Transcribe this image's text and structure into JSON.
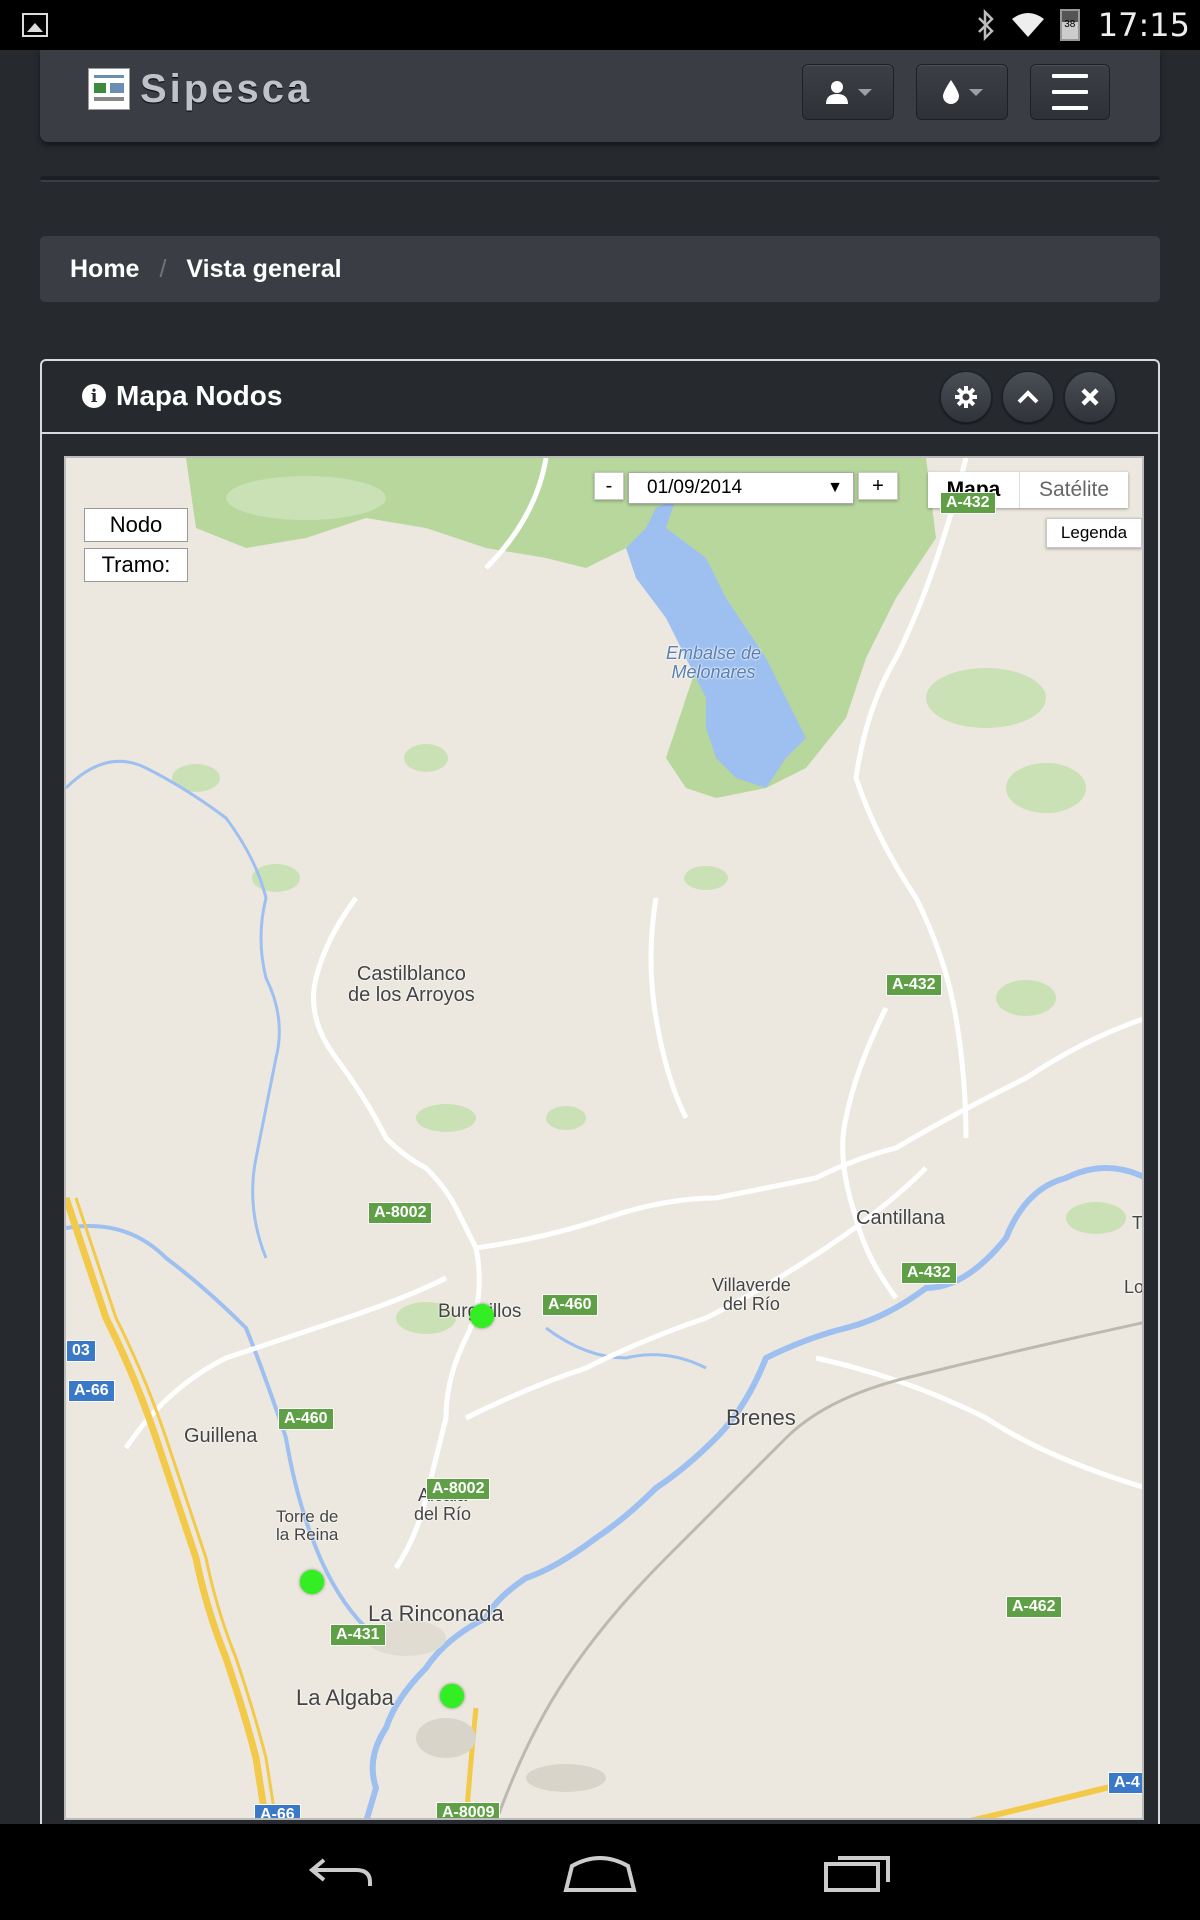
{
  "status_bar": {
    "time": "17:15",
    "battery_level": "38",
    "icons": [
      "gallery-icon",
      "bluetooth-icon",
      "wifi-icon",
      "battery-icon"
    ]
  },
  "navbar": {
    "brand": "Sipesca",
    "buttons": [
      "user-dropdown",
      "drop-dropdown",
      "menu-toggle"
    ]
  },
  "breadcrumb": {
    "home": "Home",
    "separator": "/",
    "current": "Vista general"
  },
  "panel": {
    "title": "Mapa Nodos",
    "actions": [
      "settings",
      "collapse",
      "close"
    ]
  },
  "map": {
    "date_minus": "-",
    "date_value": "01/09/2014",
    "date_plus": "+",
    "type_map": "Mapa",
    "type_satellite": "Satélite",
    "legend": "Legenda",
    "info_nodo": "Nodo",
    "info_tramo": "Tramo:",
    "places": {
      "embalse": "Embalse de\nMelonares",
      "castilblanco": "Castilblanco\nde los Arroyos",
      "cantillana": "Cantillana",
      "burguillos": "Burguillos",
      "villaverde": "Villaverde\ndel Río",
      "brenes": "Brenes",
      "guillena": "Guillena",
      "alcala": "Alcalá\ndel Río",
      "torre": "Torre de\nla Reina",
      "rinconada": "La Rinconada",
      "algaba": "La Algaba",
      "edge_t": "T",
      "edge_lo": "Lo"
    },
    "roads": {
      "a432_top": "A-432",
      "a432_mid": "A-432",
      "a432_low": "A-432",
      "a8002_n": "A-8002",
      "a460_e": "A-460",
      "a460_w": "A-460",
      "a8002_s": "A-8002",
      "a431": "A-431",
      "a462": "A-462",
      "a8009": "A-8009",
      "a66_n": "A-66",
      "a66_s": "A-66",
      "a03": "03",
      "a4": "A-4"
    },
    "colors": {
      "land": "#ece8df",
      "forest": "#b7d79d",
      "water": "#9ec0f0",
      "node": "#33ee22"
    }
  }
}
